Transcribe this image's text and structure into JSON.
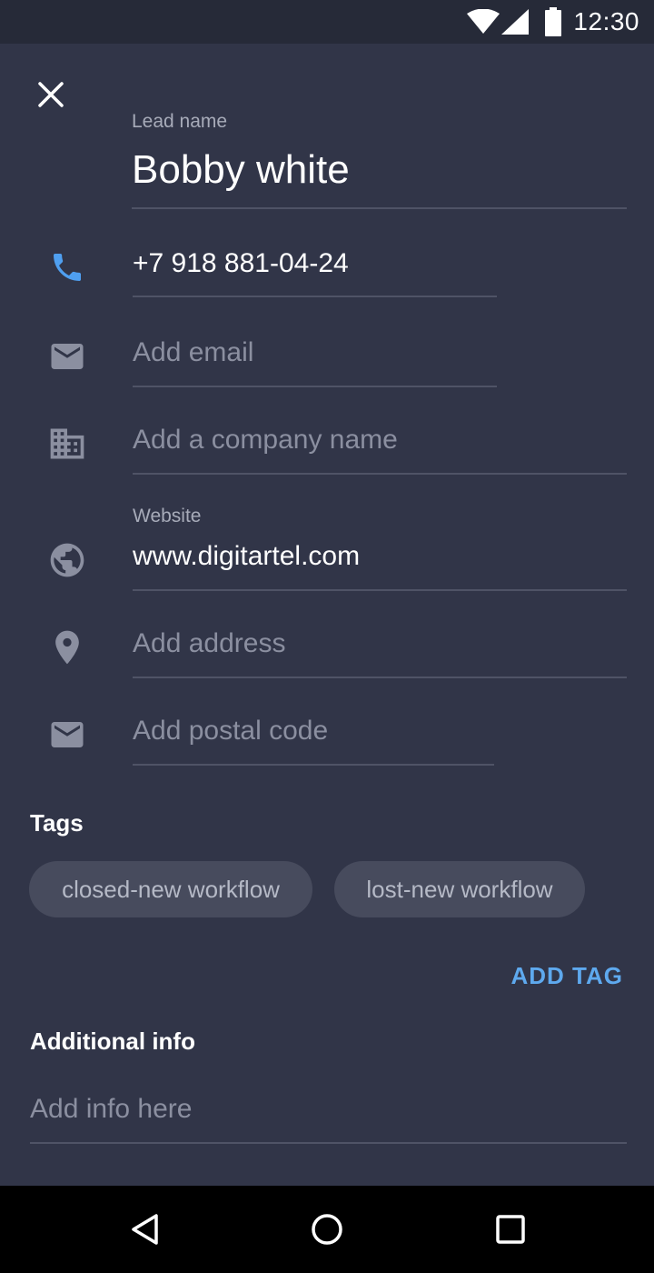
{
  "status_bar": {
    "time": "12:30",
    "icons": [
      "wifi-icon",
      "cellular-signal-icon",
      "battery-icon"
    ]
  },
  "header": {
    "close_icon": "close-icon"
  },
  "form": {
    "lead_name": {
      "label": "Lead name",
      "value": "Bobby white"
    },
    "phone": {
      "icon": "phone-icon",
      "value": "+7 918 881-04-24"
    },
    "email": {
      "icon": "email-icon",
      "placeholder": "Add email"
    },
    "company": {
      "icon": "business-icon",
      "placeholder": "Add a company name"
    },
    "website": {
      "icon": "globe-icon",
      "label": "Website",
      "value": "www.digitartel.com"
    },
    "address": {
      "icon": "location-pin-icon",
      "placeholder": "Add address"
    },
    "postal_code": {
      "icon": "email-icon",
      "placeholder": "Add postal code"
    }
  },
  "tags": {
    "title": "Tags",
    "items": [
      "closed-new workflow",
      "lost-new workflow"
    ],
    "add_label": "ADD TAG"
  },
  "additional_info": {
    "title": "Additional info",
    "placeholder": "Add info here"
  },
  "nav_bar": {
    "icons": [
      "back-icon",
      "home-icon",
      "recents-icon"
    ]
  },
  "colors": {
    "background": "#313548",
    "status_bar": "#262a38",
    "accent": "#5ea9ee",
    "phone_icon": "#4f9ff0",
    "chip_background": "#474b5d",
    "muted_icon": "#8b8fa0"
  }
}
